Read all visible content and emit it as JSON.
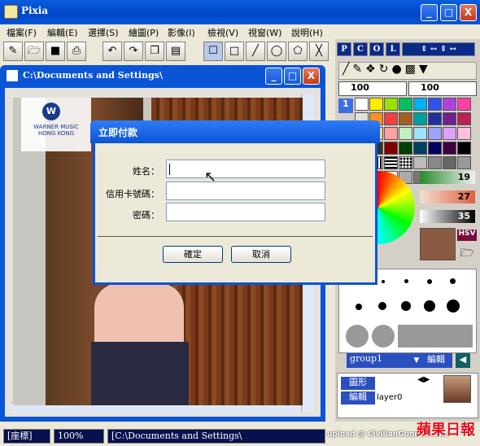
{
  "window": {
    "title": "Pixia",
    "min": "_",
    "max": "□",
    "close": "X"
  },
  "menu": [
    "檔案(F)",
    "編輯(E)",
    "選擇(S)",
    "繪圖(P)",
    "影像(I)",
    "檢視(V)",
    "視窗(W)",
    "說明(H)"
  ],
  "right_panel": {
    "tabs": [
      "P",
      "C",
      "O",
      "L"
    ],
    "size_left": "100",
    "size_right": "100",
    "layer_num": "1",
    "slider_values": [
      "19",
      "27",
      "35"
    ],
    "hsv_label": "HSV",
    "group_label": "group1",
    "edit_button": "編輯",
    "shape_button": "圖形",
    "edit_button2": "編輯",
    "layer_name": "layer0"
  },
  "document": {
    "title": "C:\\Documents and Settings\\"
  },
  "photo": {
    "logo_text": "WARNER MUSIC HONG KONG"
  },
  "dialog": {
    "title": "立即付款",
    "name_label": "姓名：",
    "card_label": "信用卡號碼：",
    "password_label": "密碼：",
    "ok": "確定",
    "cancel": "取消"
  },
  "status": {
    "mode": "[座標]",
    "zoom": "100%",
    "path": "[C:\\Documents and Settings\\"
  },
  "watermark": {
    "upload": "upload @ CivilianGunner.com",
    "brand": "蘋果日報"
  },
  "colors": {
    "titlebar": "#0a54d6"
  }
}
